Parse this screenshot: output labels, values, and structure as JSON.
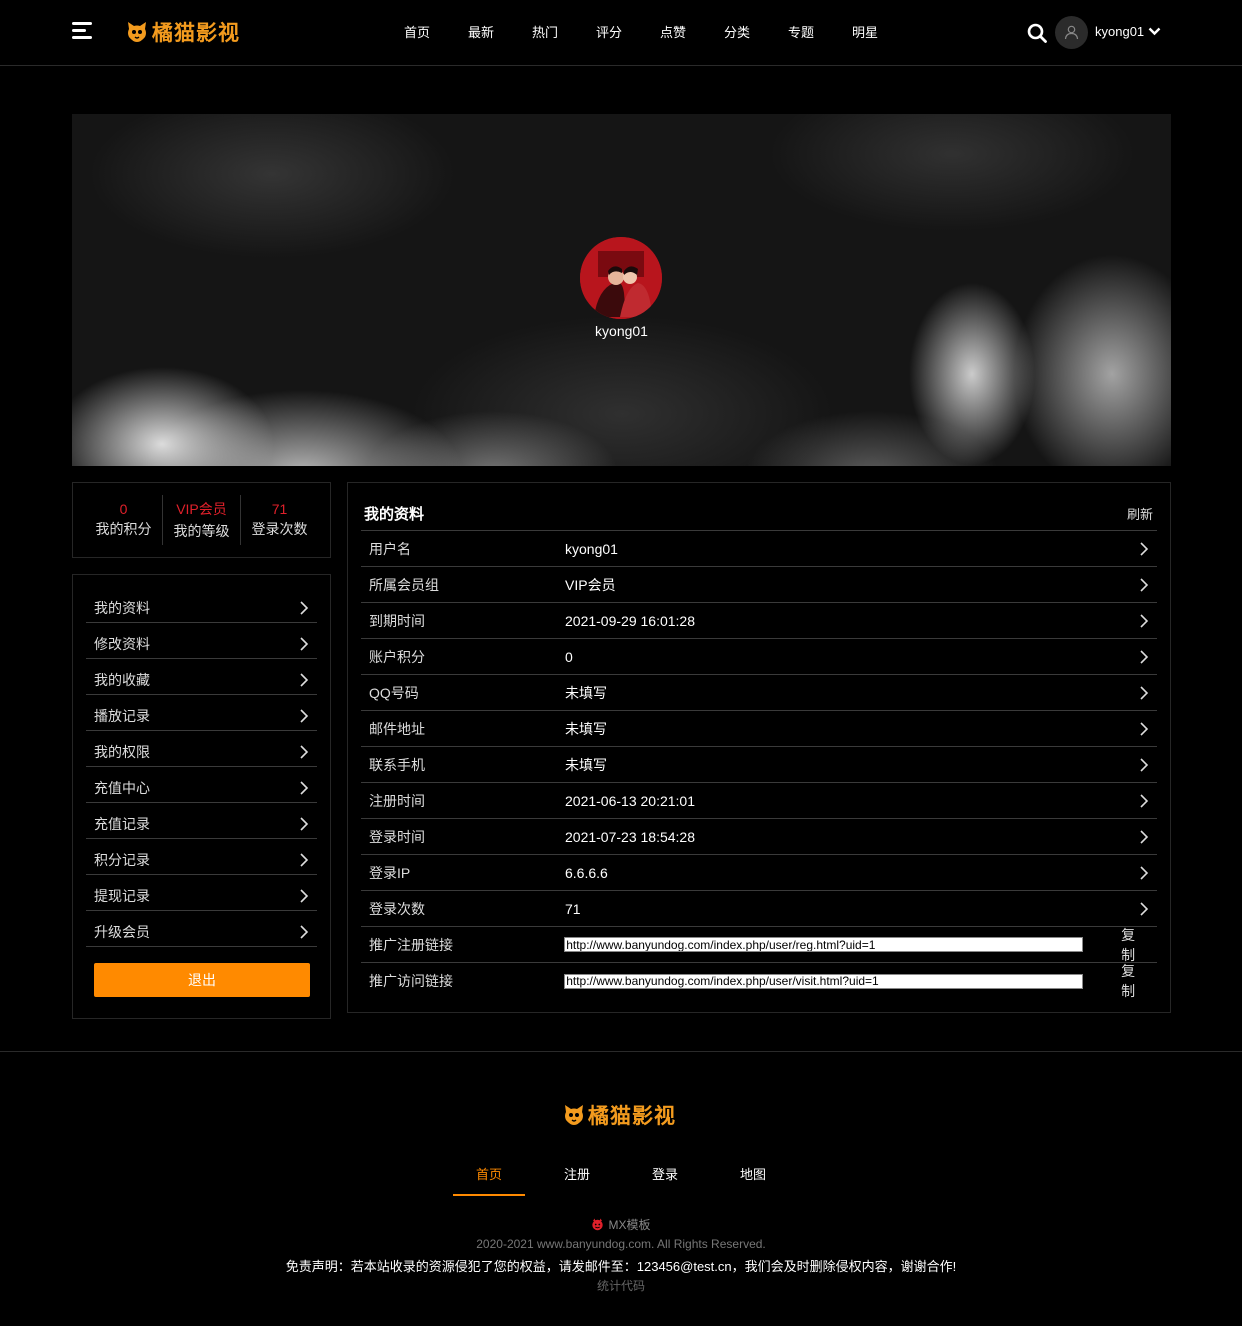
{
  "header": {
    "logo_text": "橘猫影视",
    "nav": [
      "首页",
      "最新",
      "热门",
      "评分",
      "点赞",
      "分类",
      "专题",
      "明星"
    ],
    "username": "kyong01"
  },
  "banner": {
    "username": "kyong01"
  },
  "stats": [
    {
      "value": "0",
      "label": "我的积分"
    },
    {
      "value": "VIP会员",
      "label": "我的等级"
    },
    {
      "value": "71",
      "label": "登录次数"
    }
  ],
  "sidebar": {
    "items": [
      "我的资料",
      "修改资料",
      "我的收藏",
      "播放记录",
      "我的权限",
      "充值中心",
      "充值记录",
      "积分记录",
      "提现记录",
      "升级会员"
    ],
    "logout_label": "退出"
  },
  "profile": {
    "title": "我的资料",
    "refresh_label": "刷新",
    "rows": [
      {
        "label": "用户名",
        "value": "kyong01"
      },
      {
        "label": "所属会员组",
        "value": "VIP会员"
      },
      {
        "label": "到期时间",
        "value": "2021-09-29 16:01:28"
      },
      {
        "label": "账户积分",
        "value": "0"
      },
      {
        "label": "QQ号码",
        "value": "未填写"
      },
      {
        "label": "邮件地址",
        "value": "未填写"
      },
      {
        "label": "联系手机",
        "value": "未填写"
      },
      {
        "label": "注册时间",
        "value": "2021-06-13 20:21:01"
      },
      {
        "label": "登录时间",
        "value": "2021-07-23 18:54:28"
      },
      {
        "label": "登录IP",
        "value": "6.6.6.6"
      },
      {
        "label": "登录次数",
        "value": "71"
      }
    ],
    "links": [
      {
        "label": "推广注册链接",
        "value": "http://www.banyundog.com/index.php/user/reg.html?uid=1",
        "copy_label": "复制"
      },
      {
        "label": "推广访问链接",
        "value": "http://www.banyundog.com/index.php/user/visit.html?uid=1",
        "copy_label": "复制"
      }
    ]
  },
  "footer": {
    "logo_text": "橘猫影视",
    "nav": [
      "首页",
      "注册",
      "登录",
      "地图"
    ],
    "brand": "MX模板",
    "copyright": "2020-2021 www.banyundog.com. All Rights Reserved.",
    "disclaimer_pre": "免责声明：若本站收录的资源侵犯了您的权益，请发邮件至：",
    "disclaimer_email": "123456@test.cn",
    "disclaimer_post": "，我们会及时删除侵权内容，谢谢合作!",
    "stats_code": "统计代码"
  },
  "colors": {
    "accent": "#ff8a00",
    "stat_red": "#e0202a",
    "logo_orange": "#f39b1e"
  }
}
